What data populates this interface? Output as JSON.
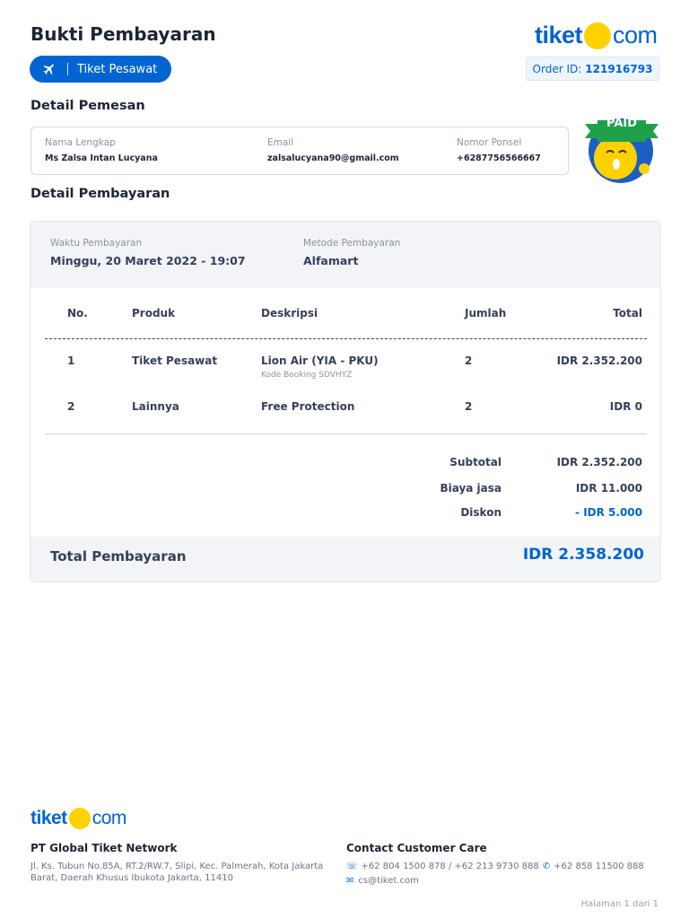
{
  "header": {
    "title": "Bukti Pembayaran",
    "logo": {
      "left": "tiket",
      "right": "com"
    },
    "product_pill": "Tiket Pesawat",
    "order_label": "Order ID:",
    "order_id": "121916793"
  },
  "pemesan": {
    "heading": "Detail Pemesan",
    "fields": [
      {
        "label": "Nama Lengkap",
        "value": "Ms Zalsa Intan Lucyana"
      },
      {
        "label": "Email",
        "value": "zalsalucyana90@gmail.com"
      },
      {
        "label": "Nomor Ponsel",
        "value": "+6287756566667"
      }
    ],
    "badge": "PAID"
  },
  "pembayaran": {
    "heading": "Detail Pembayaran",
    "waktu_label": "Waktu Pembayaran",
    "waktu": "Minggu, 20 Maret 2022 - 19:07",
    "metode_label": "Metode Pembayaran",
    "metode": "Alfamart",
    "columns": [
      "No.",
      "Produk",
      "Deskripsi",
      "Jumlah",
      "Total"
    ],
    "rows": [
      {
        "no": "1",
        "produk": "Tiket Pesawat",
        "deskripsi": "Lion Air (YIA - PKU)",
        "sub": "Kode Booking SDVHYZ",
        "jumlah": "2",
        "total": "IDR 2.352.200"
      },
      {
        "no": "2",
        "produk": "Lainnya",
        "deskripsi": "Free Protection",
        "sub": "",
        "jumlah": "2",
        "total": "IDR 0"
      }
    ],
    "summary": [
      {
        "label": "Subtotal",
        "value": "IDR 2.352.200"
      },
      {
        "label": "Biaya jasa",
        "value": "IDR 11.000"
      },
      {
        "label": "Diskon",
        "value": "- IDR 5.000"
      }
    ],
    "total_label": "Total Pembayaran",
    "total_value": "IDR 2.358.200"
  },
  "footer": {
    "company": "PT Global Tiket Network",
    "address1": "Jl. Ks. Tubun No.85A, RT.2/RW.7, Slipi, Kec. Palmerah, Kota Jakarta",
    "address2": "Barat, Daerah Khusus Ibukota Jakarta, 11410",
    "contact_heading": "Contact Customer Care",
    "phones": "+62 804 1500 878 / +62 213 9730 888",
    "whatsapp": "+62 858 11500 888",
    "email": "cs@tiket.com",
    "page": "Halaman 1 dari 1"
  },
  "colors": {
    "brand": "#0064d2",
    "yellow": "#ffd100"
  }
}
